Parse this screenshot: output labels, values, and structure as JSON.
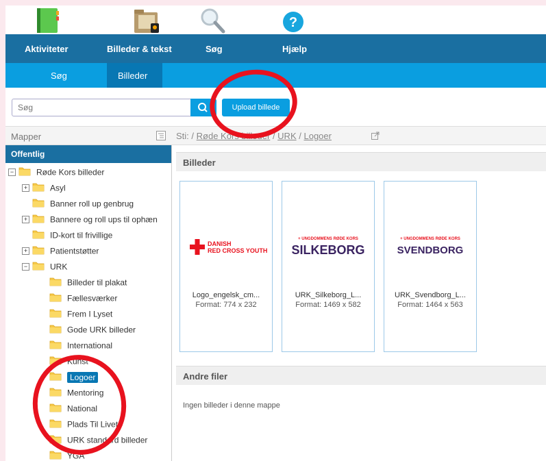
{
  "nav": {
    "primary": [
      {
        "label": "Aktiviteter",
        "icon": "book-icon"
      },
      {
        "label": "Billeder & tekst",
        "icon": "folder-icon"
      },
      {
        "label": "Søg",
        "icon": "magnifier-icon"
      },
      {
        "label": "Hjælp",
        "icon": "help-icon"
      }
    ],
    "secondary": [
      "Søg",
      "Billeder"
    ]
  },
  "search": {
    "placeholder": "Søg",
    "upload_label": "Upload billede"
  },
  "pathbar": {
    "mapper_label": "Mapper",
    "sti_label": "Sti:",
    "crumbs": [
      "Røde Kors billeder",
      "URK",
      "Logoer"
    ]
  },
  "tree": {
    "header": "Offentlig",
    "root": "Røde Kors billeder",
    "level1": [
      "Asyl",
      "Banner roll up genbrug",
      "Bannere og roll ups til ophæn",
      "ID-kort til frivillige",
      "Patientstøtter",
      "URK"
    ],
    "level2": [
      "Billeder til plakat",
      "Fællesværker",
      "Frem I Lyset",
      "Gode URK billeder",
      "International",
      "Kunst",
      "Logoer",
      "Mentoring",
      "National",
      "Plads Til Livet",
      "URK standard billeder",
      "YGA"
    ]
  },
  "main": {
    "images_heading": "Billeder",
    "format_label": "Format:",
    "cards": [
      {
        "name": "Logo_engelsk_cm...",
        "format": "774 x 232",
        "logo_line1": "DANISH",
        "logo_line2": "RED CROSS YOUTH"
      },
      {
        "name": "URK_Silkeborg_L...",
        "format": "1469 x 582",
        "logo_top": "+ UNGDOMMENS RØDE KORS",
        "logo_big": "SILKEBORG"
      },
      {
        "name": "URK_Svendborg_L...",
        "format": "1464 x 563",
        "logo_top": "+ UNGDOMMENS RØDE KORS",
        "logo_big": "SVENDBORG"
      }
    ],
    "other_heading": "Andre filer",
    "no_files": "Ingen billeder i denne mappe"
  },
  "colors": {
    "nav_primary": "#1a6fa1",
    "nav_secondary": "#0a9ee0",
    "accent_red": "#e8121e",
    "logo_purple": "#3a2361"
  }
}
